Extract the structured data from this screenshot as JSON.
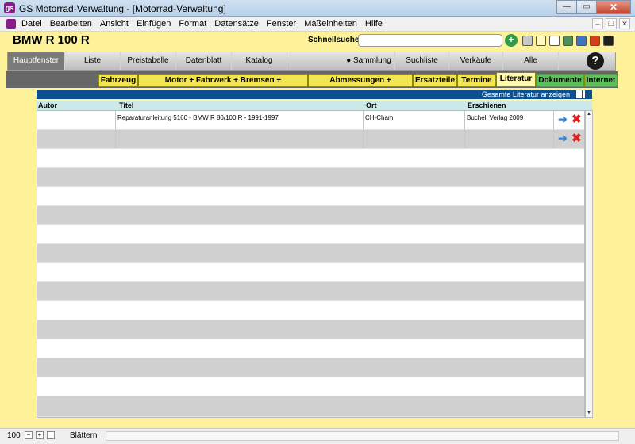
{
  "window": {
    "title": "GS Motorrad-Verwaltung - [Motorrad-Verwaltung]",
    "app_icon_text": "gs"
  },
  "menubar": {
    "items": [
      "Datei",
      "Bearbeiten",
      "Ansicht",
      "Einfügen",
      "Format",
      "Datensätze",
      "Fenster",
      "Maßeinheiten",
      "Hilfe"
    ]
  },
  "header": {
    "model_title": "BMW R 100 R",
    "quick_search_label": "Schnellsuche",
    "quick_search_value": "",
    "quick_search_go": "+",
    "swatch_colors": [
      "#c8c8c8",
      "#fff8c0",
      "#ffffff",
      "#4e8e5e",
      "#3f73c6",
      "#d2411c",
      "#202020"
    ]
  },
  "nav": {
    "items": [
      {
        "label": "Hauptfenster"
      },
      {
        "label": "Liste"
      },
      {
        "label": "Preistabelle"
      },
      {
        "label": "Datenblatt"
      },
      {
        "label": "Katalog"
      },
      {
        "label": "● Sammlung"
      },
      {
        "label": "Suchliste"
      },
      {
        "label": "Verkäufe"
      },
      {
        "label": "Alle"
      }
    ],
    "active_index": 0,
    "help_label": "?"
  },
  "tabs": {
    "items": [
      {
        "label": "Fahrzeug"
      },
      {
        "label": "Motor + Fahrwerk + Bremsen + Kraftübertragung"
      },
      {
        "label": "Abmessungen + Füllmengen"
      },
      {
        "label": "Ersatzteile"
      },
      {
        "label": "Termine"
      },
      {
        "label": "Literatur"
      },
      {
        "label": "Dokumente"
      },
      {
        "label": "Internet"
      }
    ],
    "active": "Literatur"
  },
  "literature": {
    "show_all_label": "Gesamte Literatur anzeigen",
    "columns": [
      "Autor",
      "Titel",
      "Ort",
      "Erschienen"
    ],
    "rows": [
      {
        "autor": "",
        "titel": "Reparaturanleitung 5160 - BMW R 80/100 R - 1991-1997",
        "ort": "CH-Cham",
        "erschienen": "Bucheli Verlag 2009"
      },
      {
        "autor": "",
        "titel": "",
        "ort": "",
        "erschienen": ""
      }
    ],
    "action_arrow": "➜",
    "action_delete": "✖",
    "colors": {
      "header_blue": "#0e4f8f",
      "arrow": "#2f86d6",
      "delete": "#e02020",
      "panel_yellow": "#fdf29a"
    }
  },
  "statusbar": {
    "zoom": "100",
    "zoom_minus": "−",
    "zoom_plus": "+",
    "mode": "Blättern"
  }
}
